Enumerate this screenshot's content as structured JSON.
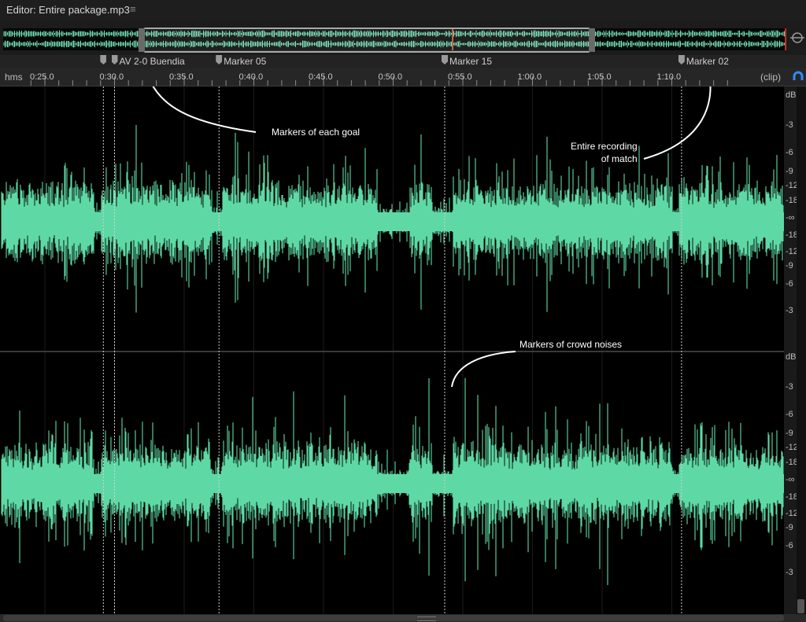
{
  "editor": {
    "title": "Editor: Entire package.mp3",
    "menu_glyph": "≡"
  },
  "ruler": {
    "unit_label": "hms",
    "end_label": "(clip)",
    "ticks": [
      "0:25.0",
      "0:30.0",
      "0:35.0",
      "0:40.0",
      "0:45.0",
      "0:50.0",
      "0:55.0",
      "1:00.0",
      "1:05.0",
      "1:10.0"
    ]
  },
  "markers": [
    {
      "name": "",
      "time": 29.2
    },
    {
      "name": "AV 2-0 Buendia",
      "time": 30.0
    },
    {
      "name": "Marker 05",
      "time": 37.5
    },
    {
      "name": "Marker 15",
      "time": 53.7
    },
    {
      "name": "Marker 02",
      "time": 70.7
    }
  ],
  "db_scale": {
    "unit": "dB",
    "upper_labels": [
      "-3",
      "-6",
      "-9",
      "-12",
      "-18",
      "-∞"
    ],
    "lower_labels": [
      "-18",
      "-12",
      "-9",
      "-6",
      "-3"
    ]
  },
  "annotations": {
    "goals": "Markers of each goal",
    "entire_line1": "Entire recording",
    "entire_line2": "of match",
    "crowd": "Markers of crowd noises"
  },
  "colors": {
    "waveform": "#5ed9a5",
    "overview_wave": "#6fe0b4",
    "marker_line": "#d0d0d0",
    "selection_border": "#a8a8a8",
    "annotation": "#ffffff"
  },
  "icons": {
    "menu": "hamburger-menu-icon",
    "snap": "snap-magnet-icon",
    "zoom": "zoom-navigator-icon"
  }
}
